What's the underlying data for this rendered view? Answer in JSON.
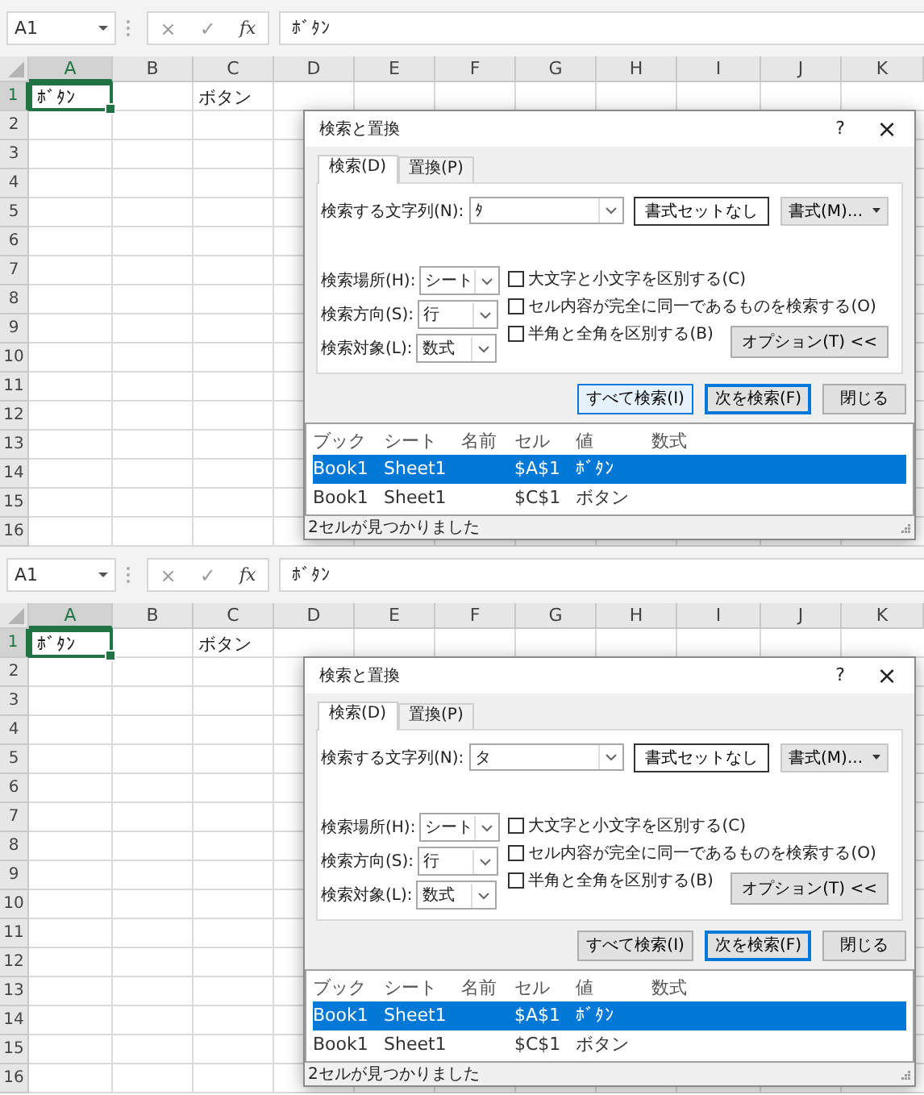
{
  "panels": [
    {
      "formula_bar": {
        "name_box": "A1",
        "buttons": [
          "×",
          "✓",
          "fx"
        ],
        "formula": "ﾎﾞﾀﾝ"
      },
      "columns": [
        {
          "label": "A",
          "selected": true
        },
        {
          "label": "B",
          "selected": false
        },
        {
          "label": "C",
          "selected": false
        },
        {
          "label": "D",
          "selected": false
        },
        {
          "label": "E",
          "selected": false
        },
        {
          "label": "F",
          "selected": false
        },
        {
          "label": "G",
          "selected": false
        },
        {
          "label": "H",
          "selected": false
        },
        {
          "label": "I",
          "selected": false
        },
        {
          "label": "J",
          "selected": false
        },
        {
          "label": "K",
          "selected": false
        }
      ],
      "rows": [
        {
          "number": "1",
          "selected": true,
          "cells": [
            {
              "text": "ﾎﾞﾀﾝ",
              "selected": true
            },
            null,
            {
              "text": "ボタン",
              "selected": false
            }
          ]
        },
        {
          "number": "2",
          "selected": false
        },
        {
          "number": "3",
          "selected": false
        },
        {
          "number": "4",
          "selected": false
        },
        {
          "number": "5",
          "selected": false
        },
        {
          "number": "6",
          "selected": false
        },
        {
          "number": "7",
          "selected": false
        },
        {
          "number": "8",
          "selected": false
        },
        {
          "number": "9",
          "selected": false
        },
        {
          "number": "10",
          "selected": false
        },
        {
          "number": "11",
          "selected": false
        },
        {
          "number": "12",
          "selected": false
        },
        {
          "number": "13",
          "selected": false
        },
        {
          "number": "14",
          "selected": false
        },
        {
          "number": "15",
          "selected": false
        },
        {
          "number": "16",
          "selected": false
        }
      ],
      "dialog": {
        "title": "検索と置換",
        "help": "?",
        "close": "×",
        "tabs": [
          {
            "label": "検索(D)",
            "selected": true
          },
          {
            "label": "置換(P)",
            "selected": false
          }
        ],
        "find_what": {
          "label": "検索する文字列(N):",
          "value": "ﾀ"
        },
        "no_format_button": "書式セットなし",
        "format_button": "書式(M)...",
        "selects": [
          {
            "label": "検索場所(H):",
            "value": "シート"
          },
          {
            "label": "検索方向(S):",
            "value": "行"
          },
          {
            "label": "検索対象(L):",
            "value": "数式"
          }
        ],
        "checkboxes": [
          {
            "label": "大文字と小文字を区別する(C)",
            "checked": false
          },
          {
            "label": "セル内容が完全に同一であるものを検索する(O)",
            "checked": false
          },
          {
            "label": "半角と全角を区別する(B)",
            "checked": false
          }
        ],
        "options_button": "オプション(T) <<",
        "buttons": [
          {
            "label": "すべて検索(I)",
            "default": false,
            "hovered": true
          },
          {
            "label": "次を検索(F)",
            "default": true,
            "hovered": false
          },
          {
            "label": "閉じる",
            "default": false,
            "hovered": false
          }
        ],
        "results": {
          "columns": [
            "ブック",
            "シート",
            "名前",
            "セル",
            "値",
            "数式"
          ],
          "rows": [
            {
              "book": "Book1",
              "sheet": "Sheet1",
              "cell": "$A$1",
              "value": "ﾎﾞﾀﾝ",
              "selected": true
            },
            {
              "book": "Book1",
              "sheet": "Sheet1",
              "cell": "$C$1",
              "value": "ボタン",
              "selected": false
            }
          ]
        },
        "status": "2セルが見つかりました"
      }
    },
    {
      "formula_bar": {
        "name_box": "A1",
        "buttons": [
          "×",
          "✓",
          "fx"
        ],
        "formula": "ﾎﾞﾀﾝ"
      },
      "columns": [
        {
          "label": "A",
          "selected": true
        },
        {
          "label": "B",
          "selected": false
        },
        {
          "label": "C",
          "selected": false
        },
        {
          "label": "D",
          "selected": false
        },
        {
          "label": "E",
          "selected": false
        },
        {
          "label": "F",
          "selected": false
        },
        {
          "label": "G",
          "selected": false
        },
        {
          "label": "H",
          "selected": false
        },
        {
          "label": "I",
          "selected": false
        },
        {
          "label": "J",
          "selected": false
        },
        {
          "label": "K",
          "selected": false
        }
      ],
      "rows": [
        {
          "number": "1",
          "selected": true,
          "cells": [
            {
              "text": "ﾎﾞﾀﾝ",
              "selected": true
            },
            null,
            {
              "text": "ボタン",
              "selected": false
            }
          ]
        },
        {
          "number": "2",
          "selected": false
        },
        {
          "number": "3",
          "selected": false
        },
        {
          "number": "4",
          "selected": false
        },
        {
          "number": "5",
          "selected": false
        },
        {
          "number": "6",
          "selected": false
        },
        {
          "number": "7",
          "selected": false
        },
        {
          "number": "8",
          "selected": false
        },
        {
          "number": "9",
          "selected": false
        },
        {
          "number": "10",
          "selected": false
        },
        {
          "number": "11",
          "selected": false
        },
        {
          "number": "12",
          "selected": false
        },
        {
          "number": "13",
          "selected": false
        },
        {
          "number": "14",
          "selected": false
        },
        {
          "number": "15",
          "selected": false
        },
        {
          "number": "16",
          "selected": false
        }
      ],
      "dialog": {
        "title": "検索と置換",
        "help": "?",
        "close": "×",
        "tabs": [
          {
            "label": "検索(D)",
            "selected": true
          },
          {
            "label": "置換(P)",
            "selected": false
          }
        ],
        "find_what": {
          "label": "検索する文字列(N):",
          "value": "タ"
        },
        "no_format_button": "書式セットなし",
        "format_button": "書式(M)...",
        "selects": [
          {
            "label": "検索場所(H):",
            "value": "シート"
          },
          {
            "label": "検索方向(S):",
            "value": "行"
          },
          {
            "label": "検索対象(L):",
            "value": "数式"
          }
        ],
        "checkboxes": [
          {
            "label": "大文字と小文字を区別する(C)",
            "checked": false
          },
          {
            "label": "セル内容が完全に同一であるものを検索する(O)",
            "checked": false
          },
          {
            "label": "半角と全角を区別する(B)",
            "checked": false
          }
        ],
        "options_button": "オプション(T) <<",
        "buttons": [
          {
            "label": "すべて検索(I)",
            "default": false,
            "hovered": false
          },
          {
            "label": "次を検索(F)",
            "default": true,
            "hovered": false
          },
          {
            "label": "閉じる",
            "default": false,
            "hovered": false
          }
        ],
        "results": {
          "columns": [
            "ブック",
            "シート",
            "名前",
            "セル",
            "値",
            "数式"
          ],
          "rows": [
            {
              "book": "Book1",
              "sheet": "Sheet1",
              "cell": "$A$1",
              "value": "ﾎﾞﾀﾝ",
              "selected": true
            },
            {
              "book": "Book1",
              "sheet": "Sheet1",
              "cell": "$C$1",
              "value": "ボタン",
              "selected": false
            }
          ]
        },
        "status": "2セルが見つかりました"
      }
    }
  ]
}
